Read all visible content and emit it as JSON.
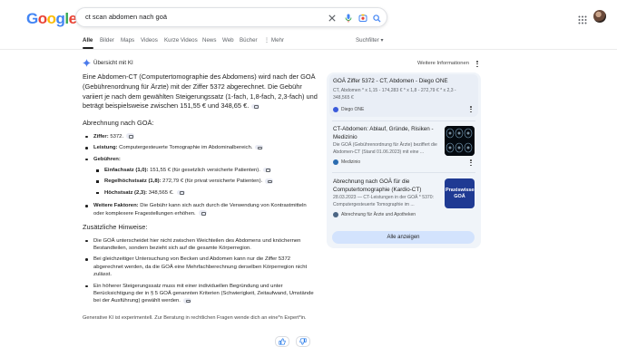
{
  "logo": {
    "text": "Google",
    "letters": [
      "G",
      "o",
      "o",
      "g",
      "l",
      "e"
    ],
    "colors": [
      "#4285f4",
      "#ea4335",
      "#fbbc05",
      "#4285f4",
      "#34a853",
      "#ea4335"
    ]
  },
  "search": {
    "query": "ct scan abdomen nach goä"
  },
  "tabs": {
    "items": [
      "Alle",
      "Bilder",
      "Maps",
      "Videos",
      "Kurze Videos",
      "News",
      "Web",
      "Bücher",
      "Mehr"
    ],
    "tools": "Suchfilter"
  },
  "overview": {
    "header": "Übersicht mit KI",
    "more_info": "Weitere Informationen",
    "intro": "Eine Abdomen-CT (Computertomographie des Abdomens) wird nach der GOÄ (Gebührenordnung für Ärzte) mit der Ziffer 5372 abgerechnet. Die Gebühr variiert je nach dem gewählten Steigerungssatz (1-fach, 1,8-fach, 2,3-fach) und beträgt beispielsweise zwischen 151,55 € und 348,65 €.",
    "billing_heading": "Abrechnung nach GOÄ:",
    "ziffer_label": "Ziffer:",
    "ziffer_value": " 5372.",
    "leistung_label": "Leistung:",
    "leistung_value": " Computergesteuerte Tomographie im Abdominalbereich.",
    "gebuehren_label": "Gebühren:",
    "einfach_label": "Einfachsatz (1,0):",
    "einfach_value": " 151,55 € (für gesetzlich versicherte Patienten).",
    "regel_label": "Regelhöchstsatz (1,8):",
    "regel_value": " 272,79 € (für privat versicherte Patienten).",
    "hoechst_label": "Höchstsatz (2,3):",
    "hoechst_value": " 348,565 €.",
    "weitere_label": "Weitere Faktoren:",
    "weitere_value": " Die Gebühr kann sich auch durch die Verwendung von Kontrastmitteln oder komplexere Fragestellungen erhöhen.",
    "hints_heading": "Zusätzliche Hinweise:",
    "hint1": "Die GOÄ unterscheidet hier nicht zwischen Weichteilen des Abdomens und knöchernen Bestandteilen, sondern bezieht sich auf die gesamte Körperregion.",
    "hint2": "Bei gleichzeitiger Untersuchung von Becken und Abdomen kann nur die Ziffer 5372 abgerechnet werden, da die GOÄ eine Mehrfachberechnung derselben Körperregion nicht zulässt.",
    "hint3": "Ein höherer Steigerungssatz muss mit einer individuellen Begründung und unter Berücksichtigung der in § 5 GOÄ genannten Kriterien (Schwierigkeit, Zeitaufwand, Umstände bei der Ausführung) gewählt werden.",
    "disclaimer": "Generative KI ist experimentell. Zur Beratung in rechtlichen Fragen wende dich an eine*n Expert*in."
  },
  "sources": {
    "items": [
      {
        "title": "GOÄ Ziffer 5372 - CT, Abdomen - Diego ONE",
        "snippet": "CT, Abdomen * x 1,15 - 174,283 € * x 1,8 - 272,79 € * x 2,3 - 348,565 €",
        "site": "Diego ONE"
      },
      {
        "title": "CT-Abdomen: Ablauf, Gründe, Risiken - Medizinio",
        "snippet": "Die GOÄ (Gebührenordnung für Ärzte) beziffert die Abdomen-CT (Stand 01.06.2023) mit eine ...",
        "site": "Medizinio"
      },
      {
        "title": "Abrechnung nach GOÄ für die Computertomographie (Kardio-CT)",
        "snippet": "28.03.2023 — CT-Leistungen in der GOÄ * 5370: Computergesteuerte Tomographie im ...",
        "site": "Abrechnung für Ärzte und Apotheken",
        "thumb_text": "Praxiswissen GOÄ"
      }
    ],
    "show_all": "Alle anzeigen"
  }
}
